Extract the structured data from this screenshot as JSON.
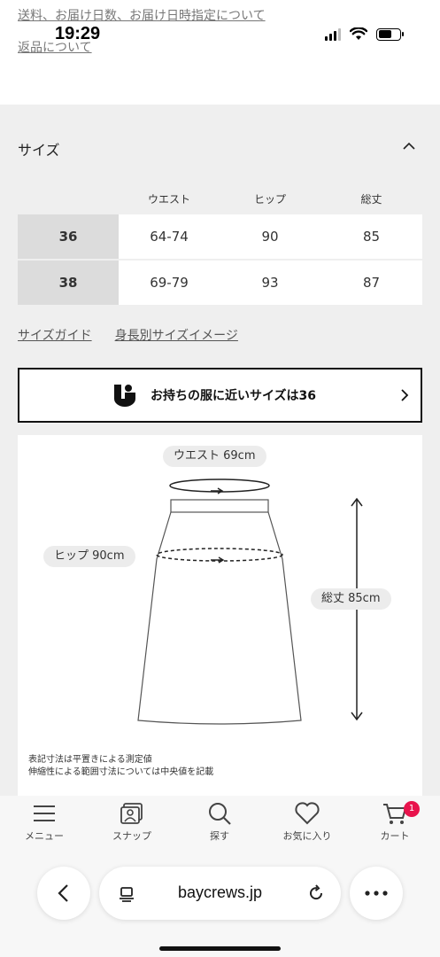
{
  "top": {
    "link1": "送料、お届け日数、お届け日時指定について",
    "link2": "返品について",
    "time": "19:29"
  },
  "size_section": {
    "title": "サイズ",
    "columns": [
      "ウエスト",
      "ヒップ",
      "総丈"
    ],
    "rows": [
      {
        "size": "36",
        "waist": "64-74",
        "hip": "90",
        "length": "85"
      },
      {
        "size": "38",
        "waist": "69-79",
        "hip": "93",
        "length": "87"
      }
    ],
    "guide_link": "サイズガイド",
    "height_link": "身長別サイズイメージ",
    "recommend_text": "お持ちの服に近いサイズは36"
  },
  "diagram": {
    "waist_label": "ウエスト 69cm",
    "hip_label": "ヒップ 90cm",
    "length_label": "総丈 85cm",
    "note1": "表記寸法は平置きによる測定値",
    "note2": "伸縮性による範囲寸法については中央値を記載"
  },
  "nav": {
    "menu": "メニュー",
    "snap": "スナップ",
    "search": "探す",
    "favorite": "お気に入り",
    "cart": "カート",
    "cart_count": "1"
  },
  "browser": {
    "url": "baycrews.jp"
  },
  "colors": {
    "badge": "#e8134c",
    "grey_bg": "#efefef",
    "size_cell": "#dcdcdc"
  }
}
